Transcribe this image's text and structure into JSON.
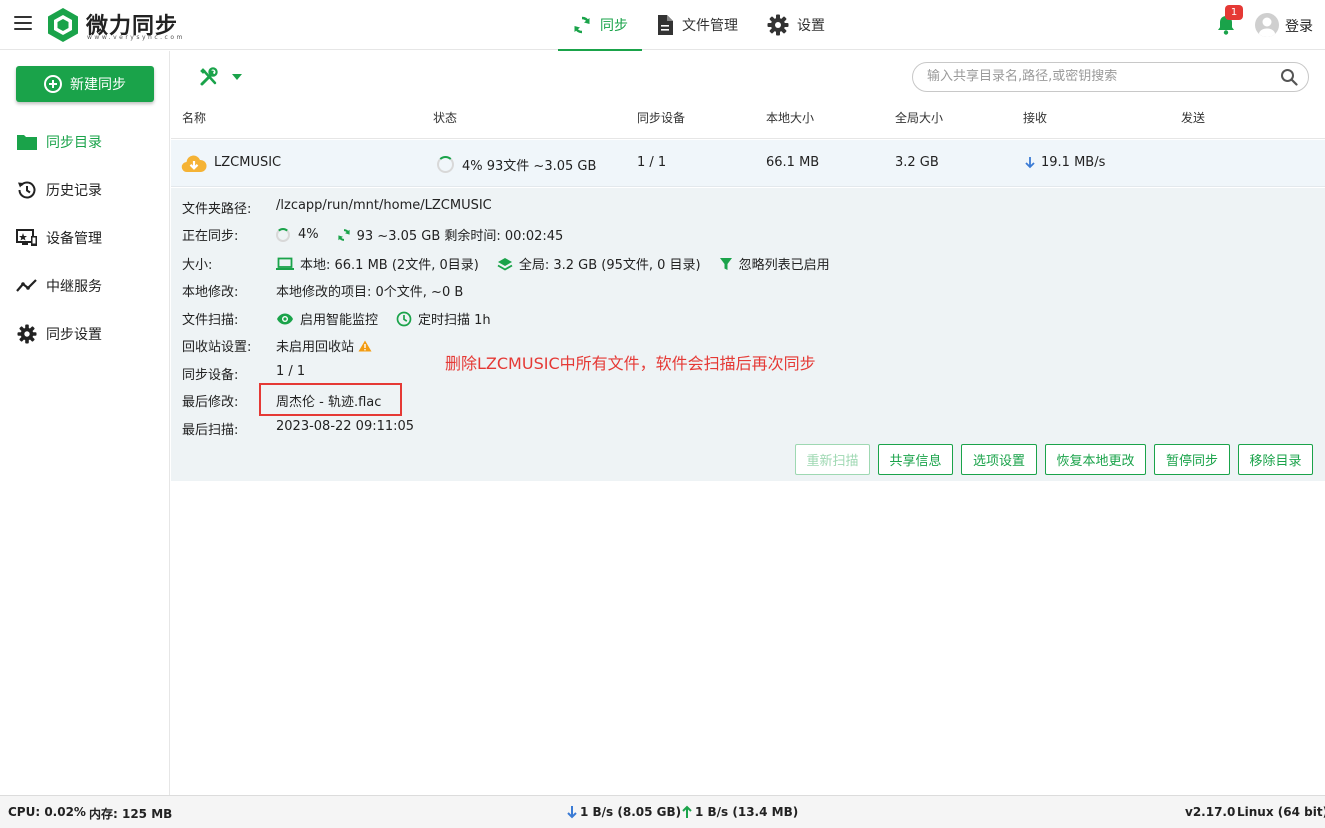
{
  "app": {
    "brand": "微力同步",
    "brand_sub": "www.verysync.com",
    "notification_count": "1",
    "login_label": "登录"
  },
  "nav": {
    "tabs": [
      {
        "label": "同步",
        "active": true
      },
      {
        "label": "文件管理"
      },
      {
        "label": "设置"
      }
    ]
  },
  "sidebar": {
    "new_button": "新建同步",
    "items": [
      {
        "label": "同步目录",
        "icon": "folder-icon",
        "active": true
      },
      {
        "label": "历史记录",
        "icon": "history-icon"
      },
      {
        "label": "设备管理",
        "icon": "device-icon"
      },
      {
        "label": "中继服务",
        "icon": "relay-icon"
      },
      {
        "label": "同步设置",
        "icon": "gear-icon"
      }
    ]
  },
  "search": {
    "placeholder": "输入共享目录名,路径,或密钥搜索"
  },
  "table": {
    "columns": [
      "名称",
      "状态",
      "同步设备",
      "本地大小",
      "全局大小",
      "接收",
      "发送"
    ],
    "row": {
      "name": "LZCMUSIC",
      "status": "4% 93文件 ~3.05 GB",
      "devices": "1 / 1",
      "local_size": "66.1 MB",
      "global_size": "3.2 GB",
      "receive": "19.1 MB/s",
      "send": ""
    }
  },
  "detail": {
    "path_label": "文件夹路径:",
    "path_value": "/lzcapp/run/mnt/home/LZCMUSIC",
    "syncing_label": "正在同步:",
    "syncing_percent": "4%",
    "syncing_info": "93 ~3.05 GB 剩余时间: 00:02:45",
    "size_label": "大小:",
    "size_local": "本地: 66.1 MB (2文件, 0目录)",
    "size_global": "全局: 3.2 GB (95文件, 0 目录)",
    "size_ignore": "忽略列表已启用",
    "local_mod_label": "本地修改:",
    "local_mod_value": "本地修改的项目: 0个文件, ~0 B",
    "scan_label": "文件扫描:",
    "scan_monitor": "启用智能监控",
    "scan_timer": "定时扫描 1h",
    "recycle_label": "回收站设置:",
    "recycle_value": "未启用回收站",
    "devices_label": "同步设备:",
    "devices_value": "1 / 1",
    "last_mod_label": "最后修改:",
    "last_mod_value": "周杰伦 - 轨迹.flac",
    "last_scan_label": "最后扫描:",
    "last_scan_value": "2023-08-22 09:11:05",
    "annotation": "删除LZCMUSIC中所有文件，软件会扫描后再次同步",
    "buttons": [
      "重新扫描",
      "共享信息",
      "选项设置",
      "恢复本地更改",
      "暂停同步",
      "移除目录"
    ]
  },
  "status": {
    "cpu": "CPU: 0.02%",
    "mem": "内存: 125 MB",
    "down": "1 B/s (8.05 GB)",
    "up": "1 B/s (13.4 MB)",
    "version": "v2.17.0",
    "os": "Linux (64 bit)"
  },
  "colors": {
    "accent": "#1aa34a",
    "alert": "#e53935",
    "warn": "#f39c12",
    "cloud": "#f5b335"
  }
}
